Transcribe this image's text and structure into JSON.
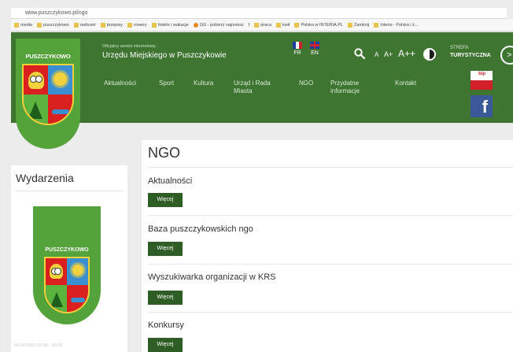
{
  "browser": {
    "url": "www.puszczykowo.pl/ngo",
    "bookmarks": [
      "media",
      "puszczykowo",
      "radnumi",
      "przepisy",
      "rowery",
      "hotele i wakacje",
      "GG - pobierz najnowsz",
      "f",
      "praca",
      "kwit",
      "Polska w INTERIA.PL",
      "Zamknij",
      "Interia - Polska i ś..."
    ]
  },
  "header": {
    "logo_text": "PUSZCZYKOWO",
    "site_small": "Oficjalny serwis internetowy",
    "site_name": "Urzędu Miejskiego w Puszczykowie",
    "lang_fr": "FR",
    "lang_en": "EN",
    "font_small": "A",
    "font_medium": "A+",
    "font_large": "A++",
    "strefa_small": "STREFA",
    "strefa": "TURYSTYCZNA",
    "arrow": ">",
    "bip_label": "bip",
    "fb_label": "f",
    "nav": [
      {
        "label": "Aktualności"
      },
      {
        "label": "Sport"
      },
      {
        "label": "Kultura"
      },
      {
        "label": "Urząd i Rada Miasta"
      },
      {
        "label": "NGO"
      },
      {
        "label": "Przydatne informacje"
      },
      {
        "label": "Kontakt"
      }
    ]
  },
  "left_panel": {
    "title": "Wydarzenia",
    "event_logo_text": "PUSZCZYKOWO",
    "date": "00.00.0000 00:00 - 00:00"
  },
  "main": {
    "title": "NGO",
    "items": [
      {
        "title": "Aktualności",
        "button": "Więcej"
      },
      {
        "title": "Baza puszczykowskich ngo",
        "button": "Więcej"
      },
      {
        "title": "Wyszukiwarka organizacji w KRS",
        "button": "Więcej"
      },
      {
        "title": "Konkursy",
        "button": "Więcej"
      }
    ]
  },
  "colors": {
    "header_green": "#3d7531",
    "logo_green": "#54a23a",
    "button_green": "#2f5d26",
    "facebook_blue": "#3b5998",
    "bip_red": "#d0202a"
  }
}
